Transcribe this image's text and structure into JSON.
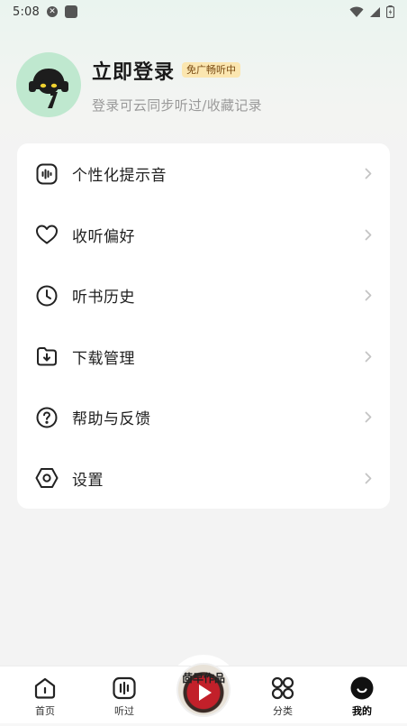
{
  "status_bar": {
    "time": "5:08",
    "icons": [
      "shield-icon",
      "notification-square-icon",
      "wifi-icon",
      "cellular-signal-icon",
      "battery-icon"
    ]
  },
  "profile": {
    "title": "立即登录",
    "badge": "免广畅听中",
    "subtitle": "登录可云同步听过/收藏记录",
    "avatar_icon": "cat-with-headphones-avatar",
    "avatar_bg": "#bfe8cf",
    "badge_bg": "#fbe6b0"
  },
  "menu": {
    "items": [
      {
        "label": "个性化提示音",
        "icon": "audio-wave-icon"
      },
      {
        "label": "收听偏好",
        "icon": "heart-icon"
      },
      {
        "label": "听书历史",
        "icon": "clock-icon"
      },
      {
        "label": "下载管理",
        "icon": "download-icon"
      },
      {
        "label": "帮助与反馈",
        "icon": "help-icon"
      },
      {
        "label": "设置",
        "icon": "settings-icon"
      }
    ]
  },
  "player": {
    "disc_text": "茴早作品"
  },
  "bottom_nav": {
    "items": [
      {
        "label": "首页",
        "icon": "home-icon",
        "active": false
      },
      {
        "label": "听过",
        "icon": "listened-icon",
        "active": false
      },
      {
        "label": "分类",
        "icon": "category-icon",
        "active": false
      },
      {
        "label": "我的",
        "icon": "profile-icon",
        "active": true
      }
    ]
  }
}
